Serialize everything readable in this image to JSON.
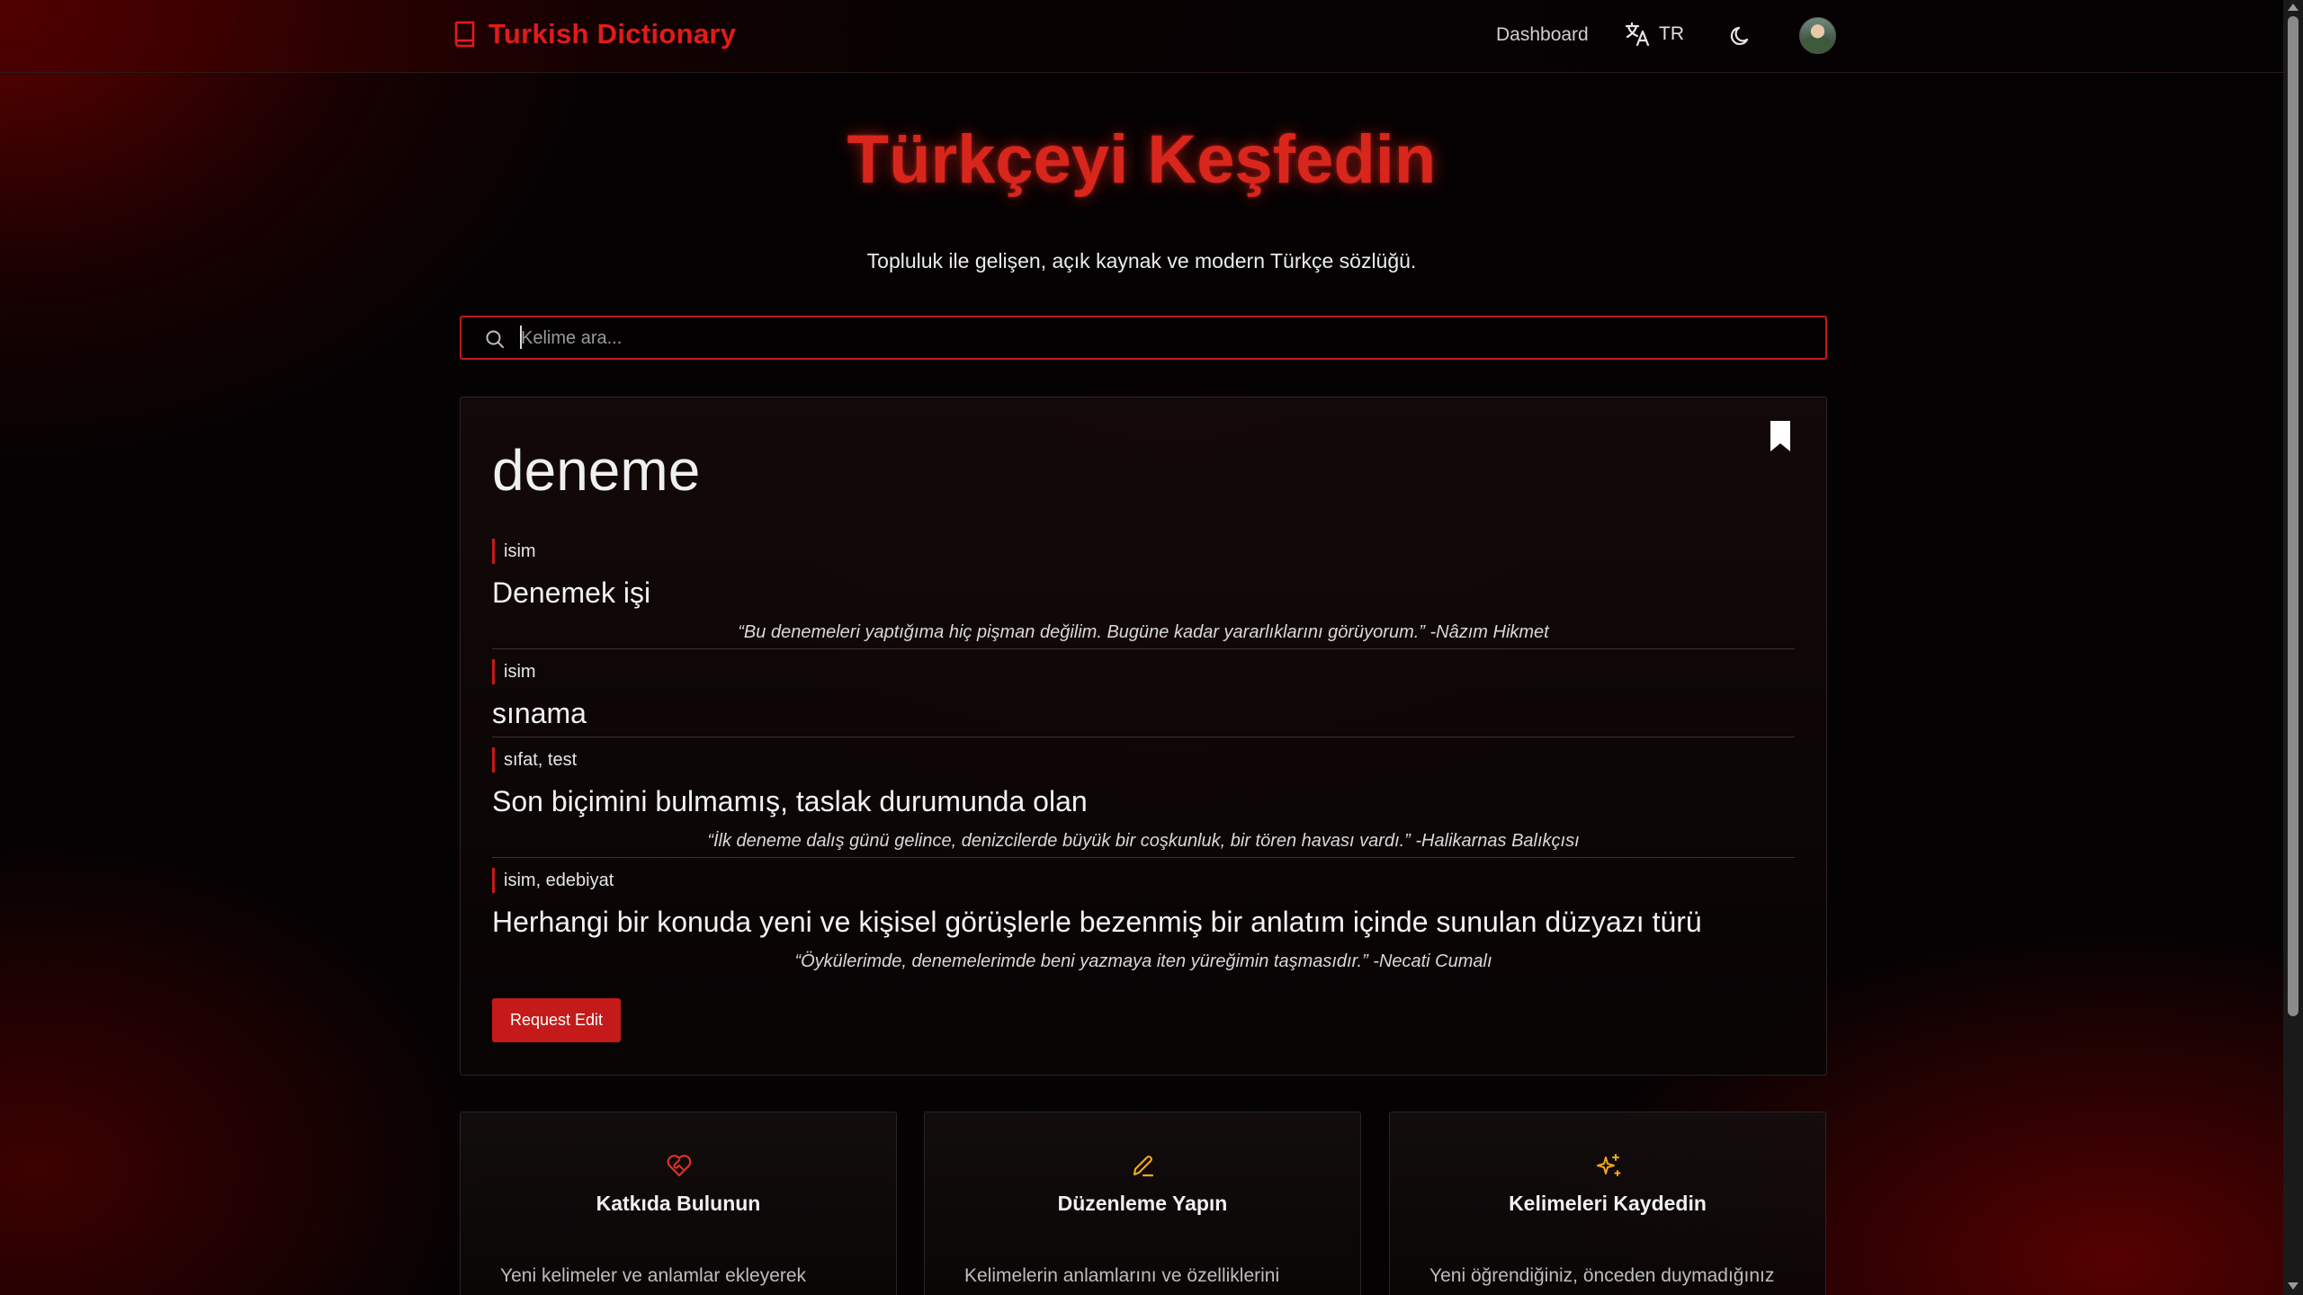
{
  "header": {
    "brand_title": "Turkish Dictionary",
    "nav_dashboard": "Dashboard",
    "language": "TR"
  },
  "hero": {
    "title": "Türkçeyi Keşfedin",
    "subtitle": "Topluluk ile gelişen, açık kaynak ve modern Türkçe sözlüğü."
  },
  "search": {
    "placeholder": "Kelime ara...",
    "value": ""
  },
  "word": {
    "title": "deneme",
    "senses": [
      {
        "tag": "isim",
        "definition": "Denemek işi",
        "quote": "“Bu denemeleri yaptığıma hiç pişman değilim. Bugüne kadar yararlıklarını görüyorum.” -Nâzım Hikmet"
      },
      {
        "tag": "isim",
        "definition": "sınama",
        "quote": ""
      },
      {
        "tag": "sıfat, test",
        "definition": "Son biçimini bulmamış, taslak durumunda olan",
        "quote": "“İlk deneme dalış günü gelince, denizcilerde büyük bir coşkunluk, bir tören havası vardı.” -Halikarnas Balıkçısı"
      },
      {
        "tag": "isim, edebiyat",
        "definition": "Herhangi bir konuda yeni ve kişisel görüşlerle bezenmiş bir anlatım içinde sunulan düzyazı türü",
        "quote": "“Öykülerimde, denemelerimde beni yazmaya iten yüreğimin taşmasıdır.” -Necati Cumalı"
      }
    ],
    "request_edit_label": "Request Edit"
  },
  "features": [
    {
      "icon": "heart-handshake-icon",
      "title": "Katkıda Bulunun",
      "description": "Yeni kelimeler ve anlamlar ekleyerek"
    },
    {
      "icon": "pencil-icon",
      "title": "Düzenleme Yapın",
      "description": "Kelimelerin anlamlarını ve özelliklerini"
    },
    {
      "icon": "sparkles-icon",
      "title": "Kelimeleri Kaydedin",
      "description": "Yeni öğrendiğiniz, önceden duymadığınız"
    }
  ],
  "colors": {
    "accent": "#c41a1a",
    "brand": "#e01b1b",
    "feature_icon_yellow": "#f0a81c",
    "background": "#050203"
  }
}
